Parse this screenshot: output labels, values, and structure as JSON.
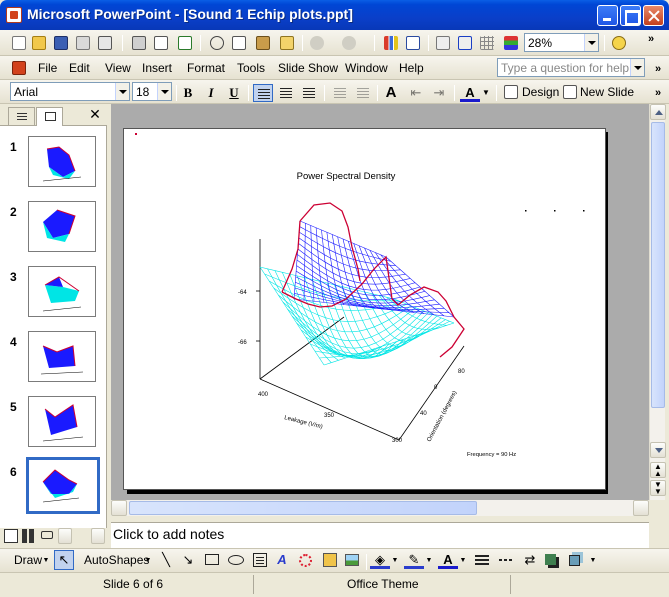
{
  "window": {
    "title": "Microsoft PowerPoint - [Sound 1 Echip plots.ppt]"
  },
  "standard_toolbar": {
    "zoom": "28%",
    "icons": [
      "new-icon",
      "open-icon",
      "save-icon",
      "permission-icon",
      "email-icon",
      "print-icon",
      "print-preview-icon",
      "spelling-icon",
      "cut-icon",
      "copy-icon",
      "paste-icon",
      "format-painter-icon",
      "undo-icon",
      "redo-icon",
      "insert-chart-icon",
      "insert-table-icon",
      "expand-icon",
      "show-formatting-icon",
      "grid-icon",
      "color-grayscale-icon",
      "help-icon"
    ]
  },
  "menu": {
    "items": [
      "File",
      "Edit",
      "View",
      "Insert",
      "Format",
      "Tools",
      "Slide Show",
      "Window",
      "Help"
    ],
    "help_placeholder": "Type a question for help"
  },
  "format_toolbar": {
    "font": "Arial",
    "size": "18",
    "bold": "B",
    "italic": "I",
    "underline": "U",
    "design_label": "Design",
    "new_slide_label": "New Slide"
  },
  "slides": {
    "numbers": [
      "1",
      "2",
      "3",
      "4",
      "5",
      "6"
    ],
    "selected": 6
  },
  "slide": {
    "title": "Power Spectral Density",
    "z_ticks": [
      "-64",
      "-66"
    ],
    "x_ticks": [
      "400",
      "350",
      "300"
    ],
    "x_label": "Leakage (V/m)",
    "y_ticks": [
      "0",
      "40",
      "80"
    ],
    "y_label": "Orientation (degrees)",
    "note": "Frequency = 90 Hz",
    "colors": {
      "mesh_top": "#1a1aff",
      "mesh_bottom": "#00e5e5",
      "edge": "#cc0033"
    }
  },
  "notes": {
    "placeholder": "Click to add notes"
  },
  "draw_toolbar": {
    "draw_label": "Draw",
    "autoshapes_label": "AutoShapes"
  },
  "status": {
    "slide": "Slide 6 of 6",
    "theme": "Office Theme"
  }
}
